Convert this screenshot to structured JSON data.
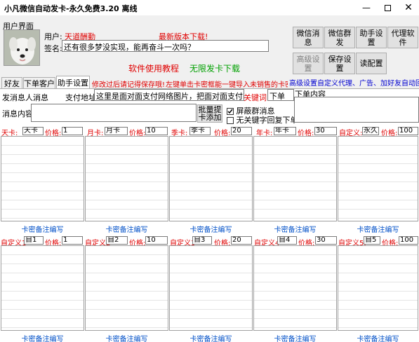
{
  "window": {
    "title": "小凡微信自动发卡-永久免费3.20   离线"
  },
  "user": {
    "group_label": "用户界面",
    "user_label": "用户:",
    "user_value": "天道酬勤",
    "sign_label": "签名:",
    "sign_value": "还有很多梦没实现，能再奋斗一次吗？",
    "new_version": "最新版本下载!",
    "tutorial_link": "软件使用教程",
    "unlimited_link": "无限发卡下载"
  },
  "right_buttons": {
    "wechat_msg": "微信消息",
    "wechat_group": "微信群发",
    "assistant_settings": "助手设置",
    "proxy_software": "代理软件",
    "advanced_settings": "高级设置",
    "save_settings": "保存设置",
    "read_config": "读配置"
  },
  "tabs": [
    {
      "label": "好友"
    },
    {
      "label": "下单客户"
    },
    {
      "label": "助手设置"
    }
  ],
  "notice": {
    "save_reminder": "修改过后请记得保存哦!",
    "import_hint": "左键单击卡密框能一键导入未销售的卡密",
    "advanced_hint": "高级设置自定义代理、广告、加好友自动回复"
  },
  "form": {
    "sender_label": "发消息人:",
    "sender_value": "消息",
    "pay_addr_label": "支付地址:",
    "pay_addr_value": "这里是面对面支付网络图片，把面对面支付图片分",
    "keyword_label": "关键词:",
    "keyword_value": "下单",
    "order_content_label": "下单内容",
    "msg_content_label": "消息内容:",
    "batch_add_button": "批量提卡添加",
    "block_group_label": "屏蔽群消息",
    "block_group_checked": true,
    "no_keyword_reply_label": "无关键字回复下单",
    "no_keyword_reply_checked": false
  },
  "price_label": "价格:",
  "note_link": "卡密备注编写",
  "row1": [
    {
      "type_label": "天卡:",
      "name": "天卡",
      "price": "1"
    },
    {
      "type_label": "月卡:",
      "name": "月卡",
      "price": "10"
    },
    {
      "type_label": "季卡:",
      "name": "季卡",
      "price": "20"
    },
    {
      "type_label": "年卡:",
      "name": "年卡",
      "price": "30"
    },
    {
      "type_label": "自定义:",
      "name": "永久",
      "price": "100"
    }
  ],
  "row2": [
    {
      "type_label": "自定义1",
      "name": "自1",
      "price": "1"
    },
    {
      "type_label": "自定义2",
      "name": "自2",
      "price": "10"
    },
    {
      "type_label": "自定义3",
      "name": "自3",
      "price": "20"
    },
    {
      "type_label": "自定义4",
      "name": "自4",
      "price": "30"
    },
    {
      "type_label": "自定义5:",
      "name": "自5",
      "price": "100"
    }
  ],
  "colors": {
    "red": "#e00000",
    "green": "#00a000",
    "blue": "#0050c8"
  }
}
